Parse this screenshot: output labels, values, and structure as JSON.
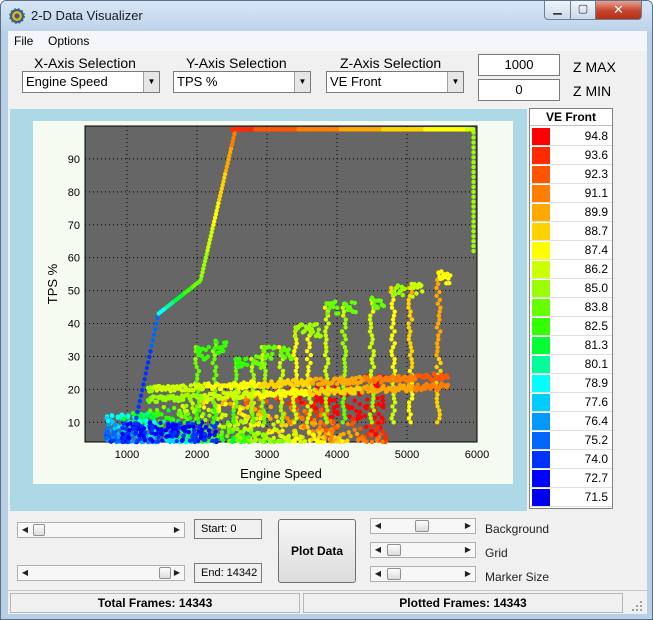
{
  "window": {
    "title": "2-D Data Visualizer",
    "icon": "gear-icon"
  },
  "menu": [
    {
      "label": "File"
    },
    {
      "label": "Options"
    }
  ],
  "axis_selection": {
    "x": {
      "title": "X-Axis Selection",
      "value": "Engine Speed"
    },
    "y": {
      "title": "Y-Axis Selection",
      "value": "TPS %"
    },
    "z": {
      "title": "Z-Axis Selection",
      "value": "VE Front"
    }
  },
  "z_range": {
    "max_value": "1000",
    "max_label": "Z MAX",
    "min_value": "0",
    "min_label": "Z MIN"
  },
  "chart_data": {
    "type": "scatter",
    "title": "",
    "xlabel": "Engine Speed",
    "ylabel": "TPS %",
    "xlim": [
      400,
      6000
    ],
    "ylim": [
      4,
      100
    ],
    "x_ticks": [
      1000,
      2000,
      3000,
      4000,
      5000,
      6000
    ],
    "y_ticks": [
      10,
      20,
      30,
      40,
      50,
      60,
      70,
      80,
      90
    ],
    "grid": true,
    "background": "#666666",
    "colorbar_label": "VE Front"
  },
  "legend": {
    "title": "VE Front",
    "entries": [
      {
        "value": "94.8",
        "color": "#ff0000"
      },
      {
        "value": "93.6",
        "color": "#ff2a00"
      },
      {
        "value": "92.3",
        "color": "#ff5400"
      },
      {
        "value": "91.1",
        "color": "#ff7e00"
      },
      {
        "value": "89.9",
        "color": "#ffa800"
      },
      {
        "value": "88.7",
        "color": "#ffd200"
      },
      {
        "value": "87.4",
        "color": "#ffff00"
      },
      {
        "value": "86.2",
        "color": "#ccff00"
      },
      {
        "value": "85.0",
        "color": "#99ff00"
      },
      {
        "value": "83.8",
        "color": "#66ff00"
      },
      {
        "value": "82.5",
        "color": "#33ff00"
      },
      {
        "value": "81.3",
        "color": "#00ff33"
      },
      {
        "value": "80.1",
        "color": "#00ff99"
      },
      {
        "value": "78.9",
        "color": "#00ffff"
      },
      {
        "value": "77.6",
        "color": "#00ccff"
      },
      {
        "value": "76.4",
        "color": "#0099ff"
      },
      {
        "value": "75.2",
        "color": "#0066ff"
      },
      {
        "value": "74.0",
        "color": "#0033ff"
      },
      {
        "value": "72.7",
        "color": "#0000ff"
      },
      {
        "value": "71.5",
        "color": "#0000ee"
      }
    ]
  },
  "frames": {
    "start_label": "Start: 0",
    "end_label": "End: 14342"
  },
  "plot_button": {
    "label": "Plot Data"
  },
  "sliders": {
    "background": "Background",
    "grid": "Grid",
    "marker_size": "Marker Size"
  },
  "status": {
    "total_frames": "Total Frames: 14343",
    "plotted_frames": "Plotted Frames: 14343"
  }
}
